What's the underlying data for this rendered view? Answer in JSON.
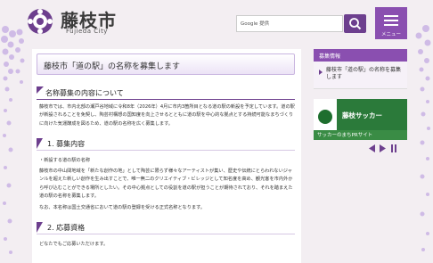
{
  "header": {
    "site_name": "藤枝市",
    "site_sub": "Fujieda City",
    "search_label": "Google 提供",
    "menu_label": "メニュー"
  },
  "main": {
    "page_title": "藤枝市「道の駅」の名称を募集します",
    "section_heading": "名称募集の内容について",
    "intro": "藤枝市では、市内北部の瀬戸谷地域に令和8年（2026年）4月に市内3箇所目となる道の駅の新設を予定しています。道の駅が新設されることを免契し、陶芸村構想の国知度を向上させるとともに道の駅を中心的な拠点とする持続可能なまちづくりに向けた気運醸成を図るため、道の駅の名称を広く募集します。",
    "h3_1": "1.  募集内容",
    "bullet": "・新設する道の駅の名称",
    "body2": "藤枝市の中山間地域を「新たな創作の地」として陶芸に限らず様々なアーティストが集い、歴史や伝統にとらわれないジャンルを超えた新しい創作を生み出すことで、唯一無二のクリエイティブ・ビレッジとして知名度を高め、観光客を市内外から呼び込むことができる場所としたい。その中心拠点としての役割を道の駅が担うことが期待されており、それを踏まえた道の駅の名称を募集します。",
    "body3": "なお、本名称は国土交通省において道の駅の登録を受ける正式名称となります。",
    "h3_2": "2.  応募資格",
    "body4": "どなたでもご応募いただけます。"
  },
  "side": {
    "heading": "募集情報",
    "item": "藤枝市「道の駅」の名称を募集します",
    "banner_name": "藤枝サッカー",
    "banner_sub": "サッカーのまちPRサイト",
    "controls": "◀ ▶ ||"
  },
  "colors": {
    "accent": "#6d3f8e",
    "menu": "#8a4fb0",
    "banner": "#2b7a3a"
  }
}
